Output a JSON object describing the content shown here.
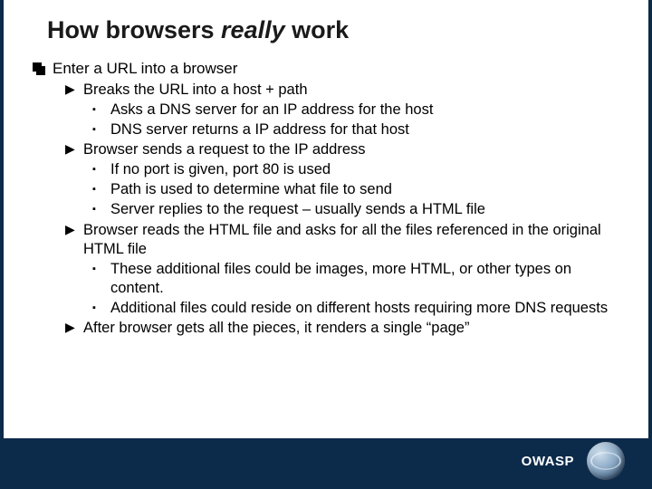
{
  "title": {
    "pre": "How browsers ",
    "em": "really",
    "post": " work"
  },
  "top": "Enter a URL into a browser",
  "items": [
    {
      "text": "Breaks the URL into a host + path",
      "sub": [
        "Asks a DNS server for an IP address for the host",
        "DNS server returns a IP address for that host"
      ]
    },
    {
      "text": "Browser sends a request to the IP address",
      "sub": [
        "If no port is given, port 80 is used",
        "Path is used to determine what file to send",
        "Server replies to the request – usually sends a HTML file"
      ]
    },
    {
      "text": "Browser reads the HTML file and asks for all the files referenced in the original HTML file",
      "sub": [
        "These additional files could be images, more HTML, or other types on content.",
        "Additional files could reside on different hosts requiring more DNS requests"
      ]
    },
    {
      "text": "After browser gets all the pieces, it renders a single “page”",
      "sub": []
    }
  ],
  "footer": "OWASP"
}
